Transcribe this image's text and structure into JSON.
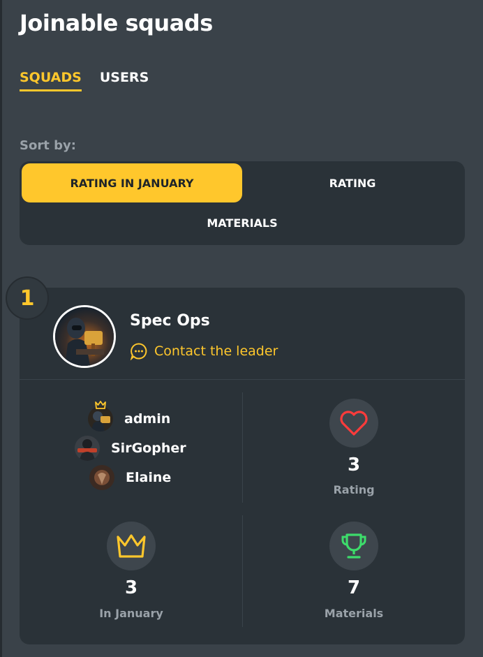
{
  "page": {
    "title": "Joinable squads"
  },
  "tabs": [
    {
      "label": "SQUADS",
      "active": true
    },
    {
      "label": "USERS",
      "active": false
    }
  ],
  "sort": {
    "label": "Sort by:",
    "options": [
      {
        "label": "RATING IN JANUARY",
        "active": true
      },
      {
        "label": "RATING",
        "active": false
      },
      {
        "label": "MATERIALS",
        "active": false
      }
    ]
  },
  "squad": {
    "rank": "1",
    "name": "Spec Ops",
    "contact_label": "Contact the leader",
    "members": [
      {
        "name": "admin",
        "leader": true
      },
      {
        "name": "SirGopher",
        "leader": false
      },
      {
        "name": "Elaine",
        "leader": false
      }
    ],
    "stats": {
      "rating": {
        "value": "3",
        "label": "Rating"
      },
      "in_january": {
        "value": "3",
        "label": "In January"
      },
      "materials": {
        "value": "7",
        "label": "Materials"
      }
    }
  },
  "colors": {
    "accent": "#ffc72c",
    "heart": "#ff3b3b",
    "trophy": "#3ddc6b",
    "background": "#3a4249",
    "card": "#2a3238"
  },
  "icons": {
    "contact": "chat-bubble-icon",
    "leader": "crown-icon",
    "rating": "heart-icon",
    "in_january": "crown-icon",
    "materials": "trophy-icon"
  }
}
